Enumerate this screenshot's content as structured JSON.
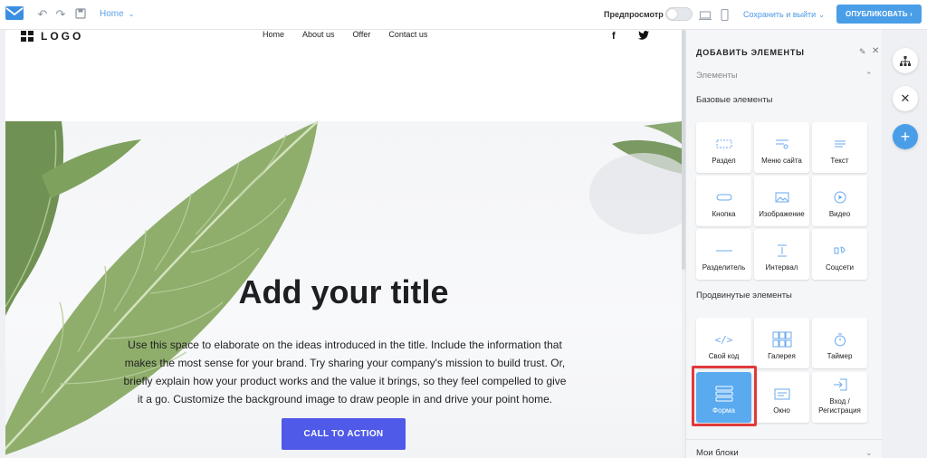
{
  "topbar": {
    "page_label": "Home",
    "preview_label": "Предпросмотр",
    "save_label": "Сохранить и выйти",
    "publish_label": "ОПУБЛИКОВАТЬ",
    "accent": "#4a9ee8"
  },
  "site": {
    "logo_text": "LOGO",
    "nav": [
      "Home",
      "About us",
      "Offer",
      "Contact us"
    ],
    "social": [
      "f",
      "t"
    ],
    "hero_title": "Add your title",
    "hero_text": "Use this space to elaborate on the ideas introduced in the title. Include the information that makes the most sense for your brand. Try sharing your company's mission to build trust. Or, briefly explain how your product works and the value it brings, so they feel compelled to give it a go. Customize the background image to draw people in and drive your point home.",
    "cta_label": "CALL TO ACTION",
    "cta_color": "#4f5ae8"
  },
  "panel": {
    "title": "ДОБАВИТЬ ЭЛЕМЕНТЫ",
    "accordion_label": "Элементы",
    "basic_heading": "Базовые элементы",
    "basic": [
      {
        "label": "Раздел",
        "icon": "section-icon"
      },
      {
        "label": "Меню сайта",
        "icon": "menu-icon"
      },
      {
        "label": "Текст",
        "icon": "text-icon"
      },
      {
        "label": "Кнопка",
        "icon": "button-icon"
      },
      {
        "label": "Изображение",
        "icon": "image-icon"
      },
      {
        "label": "Видео",
        "icon": "video-icon"
      },
      {
        "label": "Разделитель",
        "icon": "divider-icon"
      },
      {
        "label": "Интервал",
        "icon": "spacing-icon"
      },
      {
        "label": "Соцсети",
        "icon": "social-icon"
      }
    ],
    "advanced_heading": "Продвинутые элементы",
    "advanced": [
      {
        "label": "Свой код",
        "icon": "code-icon"
      },
      {
        "label": "Галерея",
        "icon": "gallery-icon"
      },
      {
        "label": "Таймер",
        "icon": "timer-icon"
      },
      {
        "label": "Форма",
        "icon": "form-icon"
      },
      {
        "label": "Окно",
        "icon": "popup-icon"
      },
      {
        "label": "Вход / Регистрация",
        "icon": "login-icon"
      }
    ],
    "my_blocks_label": "Мои блоки"
  }
}
